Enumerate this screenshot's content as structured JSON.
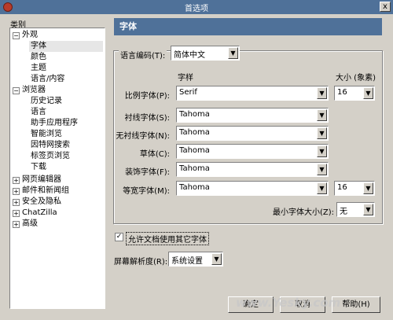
{
  "window": {
    "title": "首选项",
    "close_label": "x"
  },
  "categories_label": "类别",
  "tree": {
    "appearance": "外观",
    "font": "字体",
    "colors": "颜色",
    "theme": "主题",
    "lang_content": "语言/内容",
    "browser": "浏览器",
    "history": "历史记录",
    "languages": "语言",
    "helper_apps": "助手应用程序",
    "smart_browsing": "智能浏览",
    "internet_search": "因特网搜索",
    "tabbed_browsing": "标签页浏览",
    "downloads": "下载",
    "composer": "网页编辑器",
    "mail_news": "邮件和新闻组",
    "privacy_security": "安全及隐私",
    "chatzilla": "ChatZilla",
    "advanced": "高级"
  },
  "panel": {
    "title": "字体",
    "encoding_label": "语言编码(T):",
    "encoding_value": "简体中文",
    "col_typeface": "字样",
    "col_size": "大小 (象素)",
    "proportional_label": "比例字体(P):",
    "proportional_value": "Serif",
    "proportional_size": "16",
    "serif_label": "衬线字体(S):",
    "serif_value": "Tahoma",
    "sans_label": "无衬线字体(N):",
    "sans_value": "Tahoma",
    "cursive_label": "草体(C):",
    "cursive_value": "Tahoma",
    "fantasy_label": "装饰字体(F):",
    "fantasy_value": "Tahoma",
    "mono_label": "等宽字体(M):",
    "mono_value": "Tahoma",
    "mono_size": "16",
    "min_size_label": "最小字体大小(Z):",
    "min_size_value": "无",
    "allow_docs_label": "允许文档使用其它字体",
    "resolution_label": "屏幕解析度(R):",
    "resolution_value": "系统设置"
  },
  "buttons": {
    "ok": "确定",
    "cancel": "取消",
    "help": "帮助(H)"
  },
  "watermark": "www.Yesky.com"
}
